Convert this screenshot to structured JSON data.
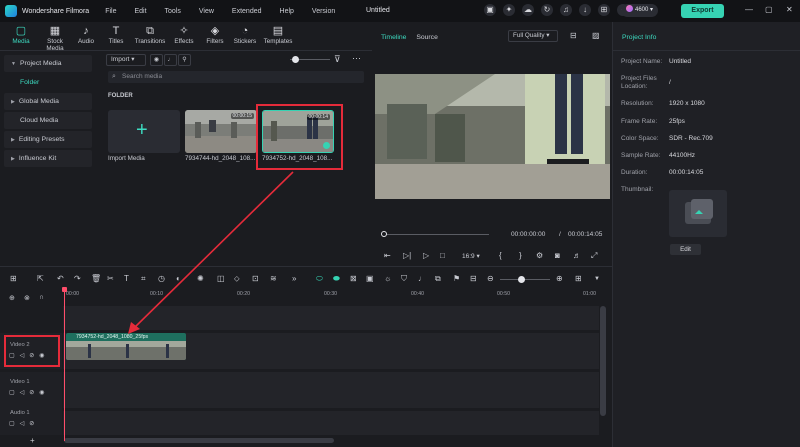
{
  "titlebar": {
    "app_name": "Wondershare Filmora",
    "menu": [
      "File",
      "Edit",
      "Tools",
      "View",
      "Extended",
      "Help",
      "Version"
    ],
    "project_title": "Untitled",
    "credits": "4600",
    "export_label": "Export"
  },
  "toolbar": {
    "tabs": [
      {
        "label": "Media",
        "icon": "media-icon"
      },
      {
        "label": "Stock Media",
        "icon": "stock-media-icon"
      },
      {
        "label": "Audio",
        "icon": "audio-icon"
      },
      {
        "label": "Titles",
        "icon": "titles-icon"
      },
      {
        "label": "Transitions",
        "icon": "transitions-icon"
      },
      {
        "label": "Effects",
        "icon": "effects-icon"
      },
      {
        "label": "Filters",
        "icon": "filters-icon"
      },
      {
        "label": "Stickers",
        "icon": "stickers-icon"
      },
      {
        "label": "Templates",
        "icon": "templates-icon"
      }
    ],
    "active_tab": "Media"
  },
  "sidebar": {
    "items": [
      {
        "label": "Project Media"
      },
      {
        "label": "Folder"
      },
      {
        "label": "Global Media"
      },
      {
        "label": "Cloud Media"
      },
      {
        "label": "Editing Presets"
      },
      {
        "label": "Influence Kit"
      }
    ]
  },
  "media": {
    "import_label": "Import",
    "search_placeholder": "Search media",
    "folder_caption": "FOLDER",
    "items": [
      {
        "name": "Import Media"
      },
      {
        "name": "7934744-hd_2048_108...",
        "duration": "00:00:15"
      },
      {
        "name": "7934752-hd_2048_108...",
        "duration": "00:00:14"
      }
    ]
  },
  "preview": {
    "tab_timeline": "Timeline",
    "tab_source": "Source",
    "quality": "Full Quality",
    "current_time": "00:00:00:00",
    "separator": "/",
    "total_time": "00:00:14:05",
    "aspect": "16:9"
  },
  "project_info": {
    "header": "Project Info",
    "rows": [
      {
        "label": "Project Name:",
        "value": "Untitled"
      },
      {
        "label": "Project Files Location:",
        "value": "/"
      },
      {
        "label": "Resolution:",
        "value": "1920 x 1080"
      },
      {
        "label": "Frame Rate:",
        "value": "25fps"
      },
      {
        "label": "Color Space:",
        "value": "SDR - Rec.709"
      },
      {
        "label": "Sample Rate:",
        "value": "44100Hz"
      },
      {
        "label": "Duration:",
        "value": "00:00:14:05"
      },
      {
        "label": "Thumbnail:",
        "value": ""
      }
    ],
    "edit_label": "Edit"
  },
  "timeline": {
    "ruler": [
      "00:00",
      "00:10",
      "00:20",
      "00:30",
      "00:40",
      "00:50",
      "01:00"
    ],
    "tracks": [
      {
        "name": "Video 2"
      },
      {
        "name": "Video 1"
      },
      {
        "name": "Audio 1"
      }
    ],
    "clip_label": "7934752-hd_2048_1080_25fps"
  },
  "colors": {
    "accent": "#36d3b3",
    "annotation": "#e52b3a"
  }
}
